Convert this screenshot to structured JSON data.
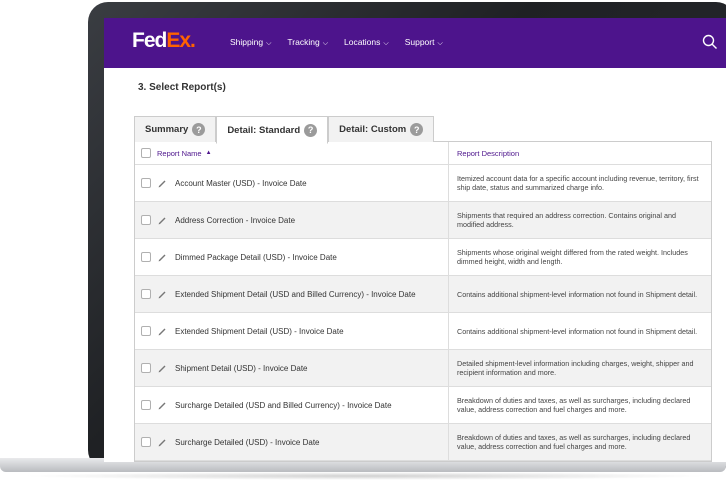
{
  "brand": {
    "fed": "Fed",
    "ex": "Ex",
    "dot": "."
  },
  "nav": {
    "items": [
      {
        "label": "Shipping"
      },
      {
        "label": "Tracking"
      },
      {
        "label": "Locations"
      },
      {
        "label": "Support"
      }
    ]
  },
  "section_title": "3. Select Report(s)",
  "tabs": [
    {
      "label": "Summary"
    },
    {
      "label": "Detail: Standard"
    },
    {
      "label": "Detail: Custom"
    }
  ],
  "table": {
    "header_name": "Report Name",
    "header_desc": "Report Description",
    "rows": [
      {
        "name": "Account Master (USD) - Invoice Date",
        "desc": "Itemized account data for a specific account including revenue, territory, first ship date, status and summarized charge info."
      },
      {
        "name": "Address Correction - Invoice Date",
        "desc": "Shipments that required an address correction. Contains original and modified address."
      },
      {
        "name": "Dimmed Package Detail (USD) - Invoice Date",
        "desc": "Shipments whose original weight differed from the rated weight. Includes dimmed height, width and length."
      },
      {
        "name": "Extended Shipment Detail (USD and Billed Currency) - Invoice Date",
        "desc": "Contains additional shipment-level information not found in Shipment detail."
      },
      {
        "name": "Extended Shipment Detail (USD) - Invoice Date",
        "desc": "Contains additional shipment-level information not found in Shipment detail."
      },
      {
        "name": "Shipment Detail (USD) - Invoice Date",
        "desc": "Detailed shipment-level information including charges, weight, shipper and recipient information and more."
      },
      {
        "name": "Surcharge Detailed (USD and Billed Currency) - Invoice Date",
        "desc": "Breakdown of duties and taxes, as well as surcharges, including declared value, address correction and fuel charges and more."
      },
      {
        "name": "Surcharge Detailed (USD) - Invoice Date",
        "desc": "Breakdown of duties and taxes, as well as surcharges, including declared value, address correction and fuel charges and more."
      }
    ]
  },
  "colors": {
    "brand_purple": "#4d148c",
    "brand_orange": "#ff6200"
  }
}
